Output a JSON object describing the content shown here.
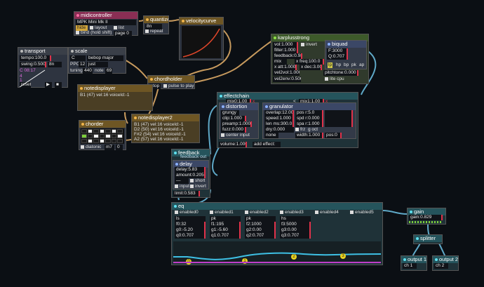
{
  "midicontroller": {
    "title": "midicontroller",
    "device": "MPK Mini Mk II",
    "hide": "hide",
    "layout": "layout",
    "list": "list",
    "bind": "bind (hold shift)",
    "page": "page 0"
  },
  "quantizer": {
    "title": "quantize",
    "div": "8n",
    "repeat": "repeat"
  },
  "velocitycurve": {
    "title": "velocitycurve"
  },
  "transport": {
    "title": "transport",
    "tempo": "tempo:100.0",
    "swing": "swing:0.500",
    "swing_div": "8n",
    "timesig": "C 08:17",
    "beat": "4",
    "bar": "1",
    "reset": "reset"
  },
  "scale": {
    "title": "scale",
    "root": "C",
    "mode": "bebop major",
    "ppo_label": "PPO",
    "ppo": "12",
    "tuning_mode": "just",
    "tuning_label": "tuning",
    "tuning": "440",
    "note_label": "note",
    "note": "69"
  },
  "chordholder": {
    "title": "chordholder",
    "stop": "stop",
    "pulse": "pulse to play"
  },
  "notedisplayer": {
    "title": "notedisplayer",
    "line1": "B1 (47) vel:16 voiceId:-1"
  },
  "notedisplayer2": {
    "title": "notedisplayer2",
    "lines": [
      "B1 (47) vel:16 voiceId:-1",
      "D2 (50) vel:16 voiceId:-1",
      "F#2 (54) vel:16 voiceId:-1",
      "A2 (57) vel:16 voiceId:-1"
    ]
  },
  "chorder": {
    "title": "chorder",
    "diatonic": "diatonic",
    "chord": "m7",
    "inv": "0"
  },
  "karplusstrong": {
    "title": "karplusstrong",
    "vol": "vol:1.000",
    "invert": "invert",
    "filter": "filter:1.000",
    "feedback": "feedback:0.9800",
    "mix": "mix",
    "xfreq": "x freq:100.0",
    "xatt": "x att:1.000",
    "xdec": "x dec:3.00",
    "vel2vol": "vel2vol:1.000",
    "pitchtone": "pitchtone:0.000",
    "vel2env": "vel2env:0.500",
    "litecpu": "lite cpu"
  },
  "biquad": {
    "title": "biquad",
    "f": "F:3000",
    "q": "Q:0.707",
    "types": [
      "lp",
      "hp",
      "bp",
      "pk",
      "ap"
    ]
  },
  "effectchain": {
    "title": "effectchain",
    "mix0": "mix0:1.00",
    "mix1": "mix1:1.00",
    "volume": "volume:1.000",
    "add": "add effect:"
  },
  "distortion": {
    "title": "distortion",
    "type": "grungy",
    "clip": "clip:1.000",
    "preamp": "preamp:1.000",
    "fuzz": "fuzz:0.000",
    "center": "center input"
  },
  "granulator": {
    "title": "granulator",
    "overlap": "overlap:12.00",
    "pos_r": "pos r:5.0",
    "speed": "speed:1.000",
    "spd_r": "spd r:0.000",
    "len": "len ms:300.0",
    "spa_r": "spa r:1.000",
    "dry": "dry:0.000",
    "frz": "frz",
    "oct": "g oct",
    "none": "none",
    "width": "width:1.000",
    "pos": "pos:0"
  },
  "feedback": {
    "title": "feedback",
    "out": "feedback out"
  },
  "delay": {
    "title": "delay",
    "delay": "delay:5.83",
    "amount": "amount:0.205",
    "short": "short",
    "input": "input",
    "invert": "invert",
    "limit": "limit:0.583"
  },
  "eq": {
    "title": "eq",
    "bands": [
      {
        "enabled": "enabled0",
        "type": "ls",
        "f": "f0:32",
        "g": "g0:-5.20",
        "q": "q0:0.707"
      },
      {
        "enabled": "enabled1",
        "type": "pk",
        "f": "f1:195",
        "g": "g1:-5.60",
        "q": "q1:0.707"
      },
      {
        "enabled": "enabled2",
        "type": "pk",
        "f": "f2:1000",
        "g": "g2:0.00",
        "q": "q2:0.707"
      },
      {
        "enabled": "enabled3",
        "type": "hs",
        "f": "f3:5000",
        "g": "g3:0.00",
        "q": "q3:0.707"
      },
      {
        "enabled": "enabled4"
      },
      {
        "enabled": "enabled5"
      }
    ],
    "markers": [
      "0",
      "1",
      "2",
      "3"
    ]
  },
  "gain": {
    "title": "gain",
    "value": "gain:0.829"
  },
  "splitter": {
    "title": "splitter"
  },
  "output1": {
    "title": "output 1",
    "ch": "ch 1"
  },
  "output2": {
    "title": "output 2",
    "ch": "ch 2"
  },
  "colors": {
    "pink": "#e07aa4",
    "orange": "#e6a02c",
    "green": "#7ccf3a",
    "cyan": "#42c6d6",
    "wire_tan": "#c79a5e",
    "bg": "#0b0f14"
  }
}
